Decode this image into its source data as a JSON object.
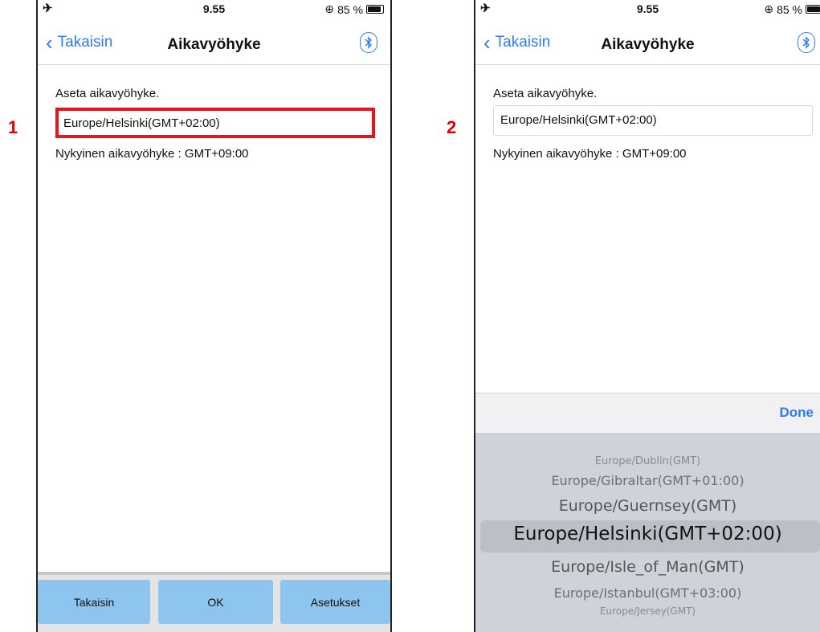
{
  "steps": [
    "1",
    "2"
  ],
  "status": {
    "time": "9.55",
    "battery": "85 %"
  },
  "nav": {
    "back": "Takaisin",
    "title": "Aikavyöhyke"
  },
  "screen": {
    "prompt": "Aseta aikavyöhyke.",
    "timezone_value": "Europe/Helsinki(GMT+02:00)",
    "current": "Nykyinen aikavyöhyke : GMT+09:00"
  },
  "buttons": {
    "back": "Takaisin",
    "ok": "OK",
    "settings": "Asetukset"
  },
  "picker": {
    "done": "Done",
    "items": [
      "Europe/Dublin(GMT)",
      "Europe/Gibraltar(GMT+01:00)",
      "Europe/Guernsey(GMT)",
      "Europe/Helsinki(GMT+02:00)",
      "Europe/Isle_of_Man(GMT)",
      "Europe/Istanbul(GMT+03:00)",
      "Europe/Jersey(GMT)"
    ]
  },
  "colors": {
    "accent": "#2f7bf5",
    "highlight": "#e8141c",
    "button": "#8ec5ef"
  },
  "icons": [
    "airplane-icon",
    "alarm-icon",
    "battery-icon",
    "chevron-left-icon",
    "bluetooth-icon"
  ]
}
